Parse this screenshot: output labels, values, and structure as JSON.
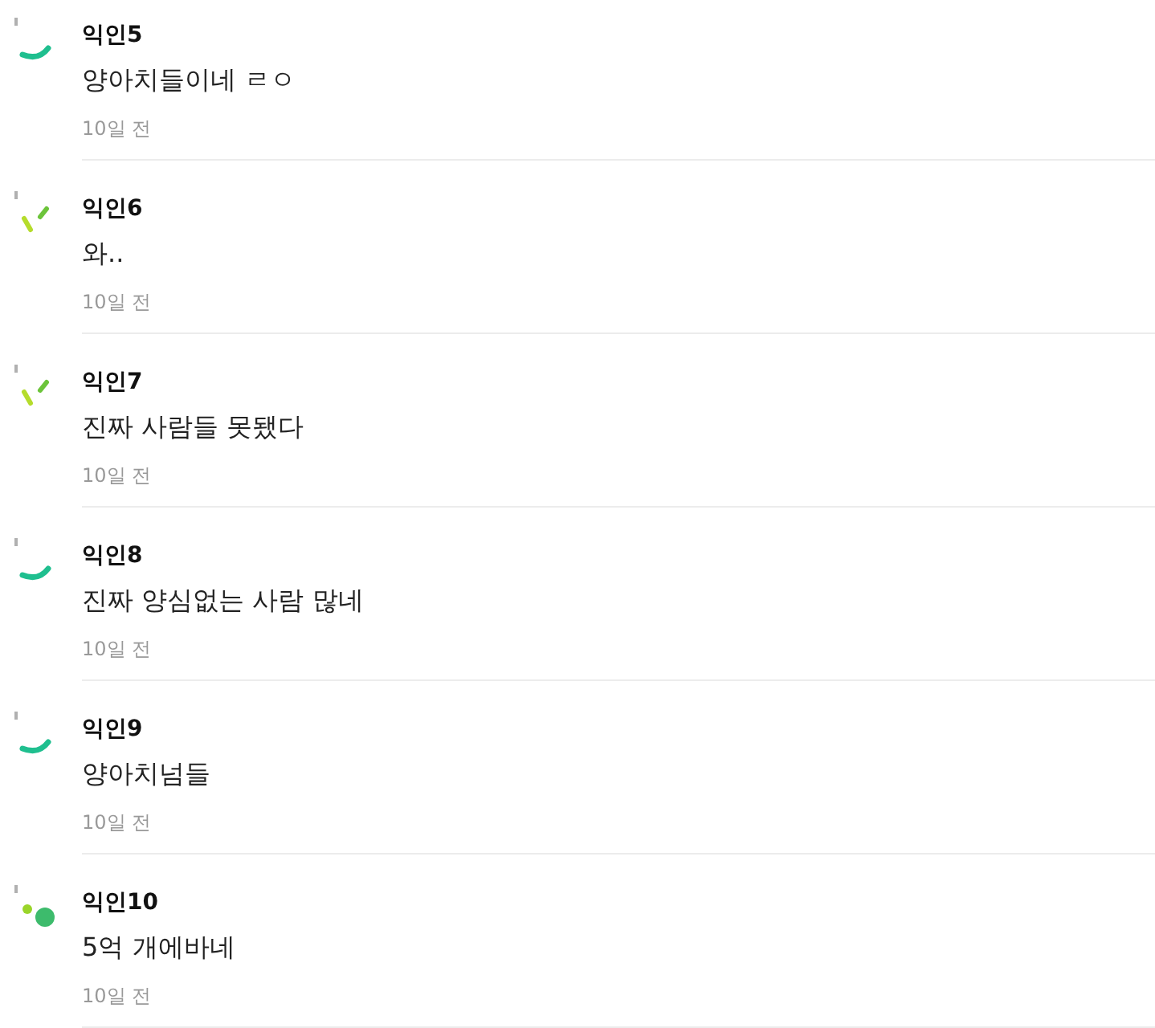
{
  "comments": [
    {
      "author": "익인5",
      "text": "양아치들이네 ㄹㅇ",
      "time": "10일 전",
      "avatar": {
        "kind": "arc",
        "color": "#1fbf8f"
      }
    },
    {
      "author": "익인6",
      "text": "와..",
      "time": "10일 전",
      "avatar": {
        "kind": "dashes",
        "color": "#b5dc2c"
      }
    },
    {
      "author": "익인7",
      "text": "진짜 사람들 못됐다",
      "time": "10일 전",
      "avatar": {
        "kind": "dashes",
        "color": "#b5dc2c"
      }
    },
    {
      "author": "익인8",
      "text": "진짜 양심없는 사람 많네",
      "time": "10일 전",
      "avatar": {
        "kind": "arc",
        "color": "#1fbf8f"
      }
    },
    {
      "author": "익인9",
      "text": "양아치넘들",
      "time": "10일 전",
      "avatar": {
        "kind": "arc",
        "color": "#1fbf8f"
      }
    },
    {
      "author": "익인10",
      "text": "5억 개에바네",
      "time": "10일 전",
      "avatar": {
        "kind": "dots",
        "color": "#3dbb6c"
      }
    }
  ]
}
